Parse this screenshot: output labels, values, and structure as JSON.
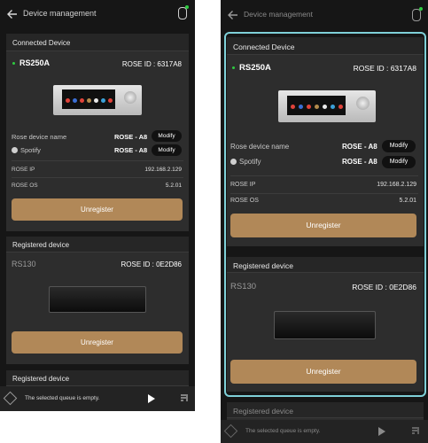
{
  "header": {
    "title": "Device management"
  },
  "connected": {
    "section_label": "Connected Device",
    "model": "RS250A",
    "rose_id": "ROSE ID : 6317A8",
    "device_name_label": "Rose device name",
    "device_name_value": "ROSE - A8",
    "spotify_label": "Spotify",
    "spotify_value": "ROSE - A8",
    "modify_label": "Modify",
    "ip_label": "ROSE IP",
    "ip_value": "192.168.2.129",
    "os_label": "ROSE OS",
    "os_value": "5.2.01",
    "unregister_label": "Unregister"
  },
  "registered": {
    "section_label": "Registered device",
    "model": "RS130",
    "rose_id": "ROSE ID : 0E2D86",
    "unregister_label": "Unregister"
  },
  "next_section": {
    "section_label": "Registered device"
  },
  "player": {
    "queue_text": "The selected queue is empty."
  },
  "colors": {
    "accent_gold": "#b18858",
    "status_green": "#2ecc40",
    "focus_frame": "#7fd0d8",
    "background": "#161616"
  }
}
